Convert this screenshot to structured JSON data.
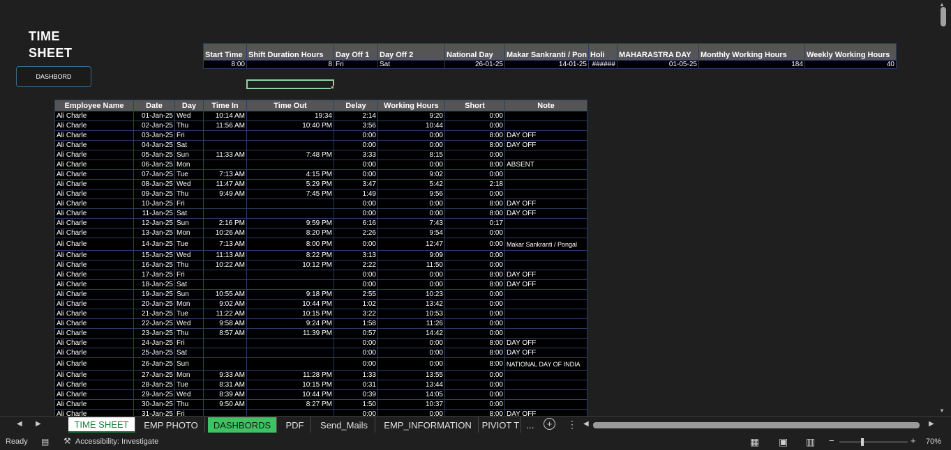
{
  "title": {
    "line1": "TIME",
    "line2": "SHEET"
  },
  "dashboard_button": "DASHBORD",
  "settings": {
    "headers": [
      "Start Time",
      "Shift Duration Hours",
      "Day Off 1",
      "Day Off 2",
      "National Day",
      "Makar Sankranti / Pon",
      "Holi",
      "MAHARASTRA DAY",
      "Monthly Working Hours",
      "Weekly Working Hours"
    ],
    "values": [
      "8:00",
      "8",
      "Fri",
      "Sat",
      "26-01-25",
      "14-01-25",
      "######",
      "01-05-25",
      "184",
      "40"
    ]
  },
  "table": {
    "headers": [
      "Employee Name",
      "Date",
      "Day",
      "Time In",
      "Time Out",
      "Delay",
      "Working Hours",
      "Short",
      "Note"
    ],
    "rows": [
      [
        "Ali Charle",
        "01-Jan-25",
        "Wed",
        "10:14 AM",
        "19:34",
        "2:14",
        "9:20",
        "0:00",
        ""
      ],
      [
        "Ali Charle",
        "02-Jan-25",
        "Thu",
        "11:56 AM",
        "10:40 PM",
        "3:56",
        "10:44",
        "0:00",
        ""
      ],
      [
        "Ali Charle",
        "03-Jan-25",
        "Fri",
        "",
        "",
        "0:00",
        "0:00",
        "8:00",
        "DAY OFF"
      ],
      [
        "Ali Charle",
        "04-Jan-25",
        "Sat",
        "",
        "",
        "0:00",
        "0:00",
        "8:00",
        "DAY OFF"
      ],
      [
        "Ali Charle",
        "05-Jan-25",
        "Sun",
        "11:33 AM",
        "7:48 PM",
        "3:33",
        "8:15",
        "0:00",
        ""
      ],
      [
        "Ali Charle",
        "06-Jan-25",
        "Mon",
        "",
        "",
        "0:00",
        "0:00",
        "8:00",
        "ABSENT"
      ],
      [
        "Ali Charle",
        "07-Jan-25",
        "Tue",
        "7:13 AM",
        "4:15 PM",
        "0:00",
        "9:02",
        "0:00",
        ""
      ],
      [
        "Ali Charle",
        "08-Jan-25",
        "Wed",
        "11:47 AM",
        "5:29 PM",
        "3:47",
        "5:42",
        "2:18",
        ""
      ],
      [
        "Ali Charle",
        "09-Jan-25",
        "Thu",
        "9:49 AM",
        "7:45 PM",
        "1:49",
        "9:56",
        "0:00",
        ""
      ],
      [
        "Ali Charle",
        "10-Jan-25",
        "Fri",
        "",
        "",
        "0:00",
        "0:00",
        "8:00",
        "DAY OFF"
      ],
      [
        "Ali Charle",
        "11-Jan-25",
        "Sat",
        "",
        "",
        "0:00",
        "0:00",
        "8:00",
        "DAY OFF"
      ],
      [
        "Ali Charle",
        "12-Jan-25",
        "Sun",
        "2:16 PM",
        "9:59 PM",
        "6:16",
        "7:43",
        "0:17",
        ""
      ],
      [
        "Ali Charle",
        "13-Jan-25",
        "Mon",
        "10:26 AM",
        "8:20 PM",
        "2:26",
        "9:54",
        "0:00",
        ""
      ],
      [
        "Ali Charle",
        "14-Jan-25",
        "Tue",
        "7:13 AM",
        "8:00 PM",
        "0:00",
        "12:47",
        "0:00",
        "Makar Sankranti / Pongal"
      ],
      [
        "Ali Charle",
        "15-Jan-25",
        "Wed",
        "11:13 AM",
        "8:22 PM",
        "3:13",
        "9:09",
        "0:00",
        ""
      ],
      [
        "Ali Charle",
        "16-Jan-25",
        "Thu",
        "10:22 AM",
        "10:12 PM",
        "2:22",
        "11:50",
        "0:00",
        ""
      ],
      [
        "Ali Charle",
        "17-Jan-25",
        "Fri",
        "",
        "",
        "0:00",
        "0:00",
        "8:00",
        "DAY OFF"
      ],
      [
        "Ali Charle",
        "18-Jan-25",
        "Sat",
        "",
        "",
        "0:00",
        "0:00",
        "8:00",
        "DAY OFF"
      ],
      [
        "Ali Charle",
        "19-Jan-25",
        "Sun",
        "10:55 AM",
        "9:18 PM",
        "2:55",
        "10:23",
        "0:00",
        ""
      ],
      [
        "Ali Charle",
        "20-Jan-25",
        "Mon",
        "9:02 AM",
        "10:44 PM",
        "1:02",
        "13:42",
        "0:00",
        ""
      ],
      [
        "Ali Charle",
        "21-Jan-25",
        "Tue",
        "11:22 AM",
        "10:15 PM",
        "3:22",
        "10:53",
        "0:00",
        ""
      ],
      [
        "Ali Charle",
        "22-Jan-25",
        "Wed",
        "9:58 AM",
        "9:24 PM",
        "1:58",
        "11:26",
        "0:00",
        ""
      ],
      [
        "Ali Charle",
        "23-Jan-25",
        "Thu",
        "8:57 AM",
        "11:39 PM",
        "0:57",
        "14:42",
        "0:00",
        ""
      ],
      [
        "Ali Charle",
        "24-Jan-25",
        "Fri",
        "",
        "",
        "0:00",
        "0:00",
        "8:00",
        "DAY OFF"
      ],
      [
        "Ali Charle",
        "25-Jan-25",
        "Sat",
        "",
        "",
        "0:00",
        "0:00",
        "8:00",
        "DAY OFF"
      ],
      [
        "Ali Charle",
        "26-Jan-25",
        "Sun",
        "",
        "",
        "0:00",
        "0:00",
        "8:00",
        "NATIONAL DAY OF INDIA"
      ],
      [
        "Ali Charle",
        "27-Jan-25",
        "Mon",
        "9:33 AM",
        "11:28 PM",
        "1:33",
        "13:55",
        "0:00",
        ""
      ],
      [
        "Ali Charle",
        "28-Jan-25",
        "Tue",
        "8:31 AM",
        "10:15 PM",
        "0:31",
        "13:44",
        "0:00",
        ""
      ],
      [
        "Ali Charle",
        "29-Jan-25",
        "Wed",
        "8:39 AM",
        "10:44 PM",
        "0:39",
        "14:05",
        "0:00",
        ""
      ],
      [
        "Ali Charle",
        "30-Jan-25",
        "Thu",
        "9:50 AM",
        "8:27 PM",
        "1:50",
        "10:37",
        "0:00",
        ""
      ],
      [
        "Ali Charle",
        "31-Jan-25",
        "Fri",
        "",
        "",
        "0:00",
        "0:00",
        "8:00",
        "DAY OFF"
      ]
    ]
  },
  "tabs": {
    "items": [
      "TIME SHEET",
      "EMP PHOTO",
      "DASHBORDS",
      "PDF",
      "Send_Mails",
      "EMP_INFORMATION",
      "PIVIOT T"
    ],
    "more": "...",
    "add": "+",
    "options": "⋮"
  },
  "status": {
    "ready": "Ready",
    "accessibility": "Accessibility: Investigate",
    "zoom": "70%"
  }
}
